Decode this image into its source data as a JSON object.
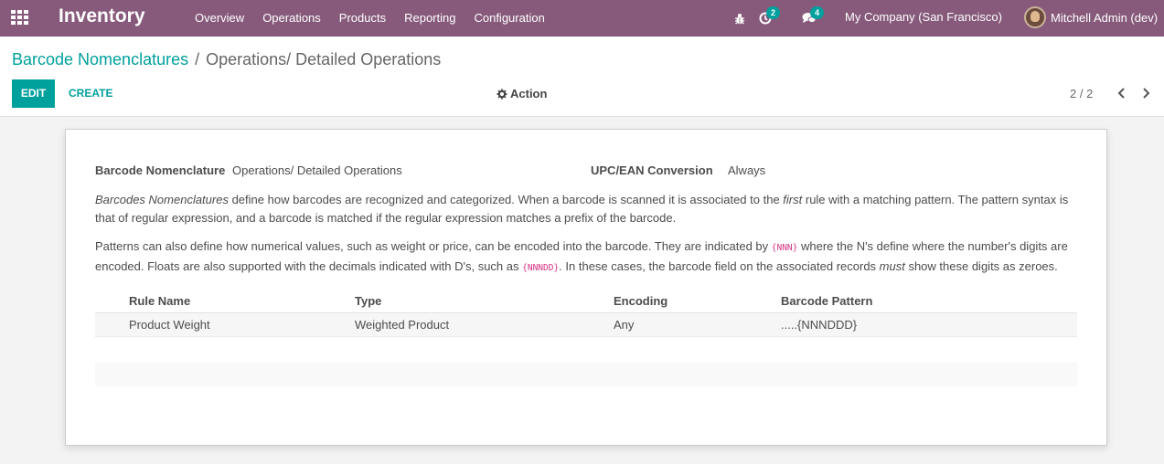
{
  "navbar": {
    "app_title": "Inventory",
    "menu": [
      "Overview",
      "Operations",
      "Products",
      "Reporting",
      "Configuration"
    ],
    "activity_count": "2",
    "messages_count": "4",
    "company": "My Company (San Francisco)",
    "user": "Mitchell Admin (dev)",
    "bg_color": "#875a7b"
  },
  "breadcrumb": {
    "parent": "Barcode Nomenclatures",
    "separator": "/",
    "current": "Operations/ Detailed Operations"
  },
  "buttons": {
    "edit": "EDIT",
    "create": "CREATE",
    "action": "Action"
  },
  "pager": {
    "value": "2 / 2"
  },
  "form": {
    "nomenclature_label": "Barcode Nomenclature",
    "nomenclature_value": "Operations/ Detailed Operations",
    "upc_label": "UPC/EAN Conversion",
    "upc_value": "Always",
    "para1": {
      "em1": "Barcodes Nomenclatures",
      "t1": " define how barcodes are recognized and categorized. When a barcode is scanned it is associated to the ",
      "em2": "first",
      "t2": " rule with a matching pattern. The pattern syntax is that of regular expression, and a barcode is matched if the regular expression matches a prefix of the barcode."
    },
    "para2": {
      "t1": "Patterns can also define how numerical values, such as weight or price, can be encoded into the barcode. They are indicated by ",
      "code1": "{NNN}",
      "t2": " where the N's define where the number's digits are encoded. Floats are also supported with the decimals indicated with D's, such as ",
      "code2": "{NNNDD}",
      "t3": ". In these cases, the barcode field on the associated records ",
      "em1": "must",
      "t4": " show these digits as zeroes."
    }
  },
  "table": {
    "headers": [
      "Rule Name",
      "Type",
      "Encoding",
      "Barcode Pattern"
    ],
    "rows": [
      [
        "Product Weight",
        "Weighted Product",
        "Any",
        ".....{NNNDDD}"
      ]
    ]
  },
  "colors": {
    "accent": "#00a09d",
    "code": "#d63384"
  }
}
